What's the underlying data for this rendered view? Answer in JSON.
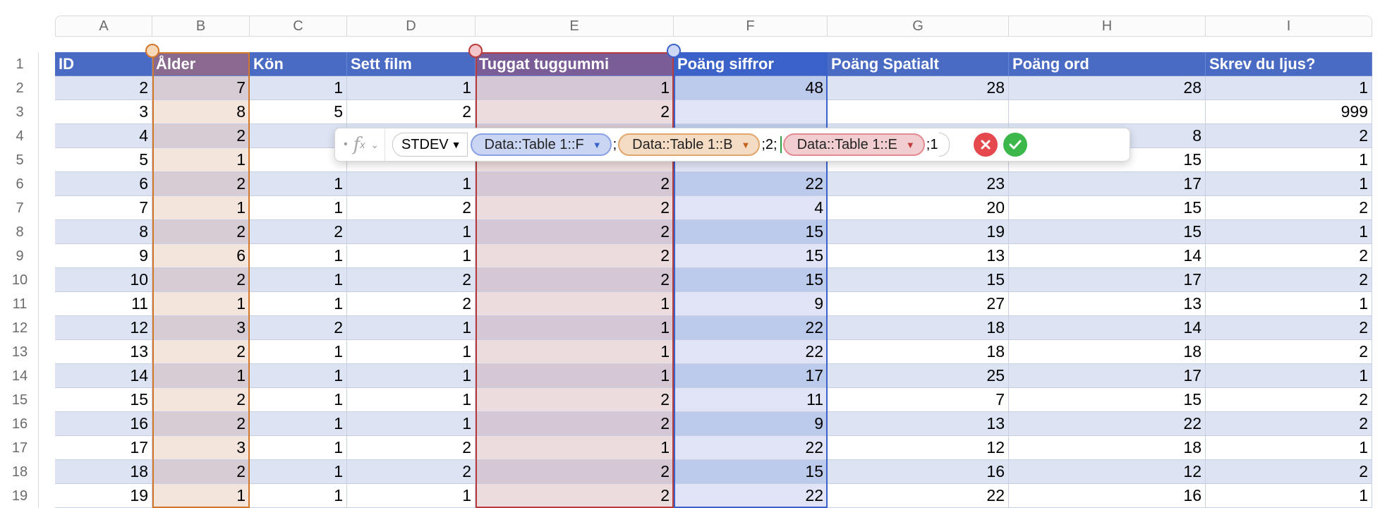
{
  "columns": [
    "A",
    "B",
    "C",
    "D",
    "E",
    "F",
    "G",
    "H",
    "I"
  ],
  "row_numbers": [
    "1",
    "2",
    "3",
    "4",
    "5",
    "6",
    "7",
    "8",
    "9",
    "10",
    "11",
    "12",
    "13",
    "14",
    "15",
    "16",
    "17",
    "18",
    "19"
  ],
  "headers": [
    "ID",
    "Ålder",
    "Kön",
    "Sett film",
    "Tuggat tuggummi",
    "Poäng siffror",
    "Poäng Spatialt",
    "Poäng ord",
    "Skrev du ljus?"
  ],
  "rows": [
    [
      "2",
      "7",
      "1",
      "1",
      "1",
      "48",
      "28",
      "28",
      "1"
    ],
    [
      "3",
      "8",
      "5",
      "2",
      "2",
      "",
      "",
      "",
      "999"
    ],
    [
      "4",
      "2",
      "",
      "",
      "",
      "",
      "",
      "8",
      "2"
    ],
    [
      "5",
      "1",
      "",
      "",
      "",
      "",
      "",
      "15",
      "1"
    ],
    [
      "6",
      "2",
      "1",
      "1",
      "2",
      "22",
      "23",
      "17",
      "1"
    ],
    [
      "7",
      "1",
      "1",
      "2",
      "2",
      "4",
      "20",
      "15",
      "2"
    ],
    [
      "8",
      "2",
      "2",
      "1",
      "2",
      "15",
      "19",
      "15",
      "1"
    ],
    [
      "9",
      "6",
      "1",
      "1",
      "2",
      "15",
      "13",
      "14",
      "2"
    ],
    [
      "10",
      "2",
      "1",
      "2",
      "2",
      "15",
      "15",
      "17",
      "2"
    ],
    [
      "11",
      "1",
      "1",
      "2",
      "1",
      "9",
      "27",
      "13",
      "1"
    ],
    [
      "12",
      "3",
      "2",
      "1",
      "1",
      "22",
      "18",
      "14",
      "2"
    ],
    [
      "13",
      "2",
      "1",
      "1",
      "1",
      "22",
      "18",
      "18",
      "2"
    ],
    [
      "14",
      "1",
      "1",
      "1",
      "1",
      "17",
      "25",
      "17",
      "1"
    ],
    [
      "15",
      "2",
      "1",
      "1",
      "2",
      "11",
      "7",
      "15",
      "2"
    ],
    [
      "16",
      "2",
      "1",
      "1",
      "2",
      "9",
      "13",
      "22",
      "2"
    ],
    [
      "17",
      "3",
      "1",
      "2",
      "1",
      "22",
      "12",
      "18",
      "1"
    ],
    [
      "18",
      "2",
      "1",
      "2",
      "2",
      "15",
      "16",
      "12",
      "2"
    ],
    [
      "19",
      "1",
      "1",
      "1",
      "2",
      "22",
      "22",
      "16",
      "1"
    ]
  ],
  "formula": {
    "function_name": "STDEV",
    "arg1": "Data::Table 1::F",
    "sep1": ";",
    "arg2": "Data::Table 1::B",
    "sep2": ";2;",
    "arg3": "Data::Table 1::E",
    "sep3": ";1",
    "fx_icon": "function-icon",
    "colors": {
      "blue": "#3a62c8",
      "orange": "#e2a56a",
      "red": "#e38a93"
    }
  },
  "selection_colors": {
    "column_B": "#d2772a",
    "column_E": "#b83a3a",
    "column_F": "#3a62c8"
  }
}
